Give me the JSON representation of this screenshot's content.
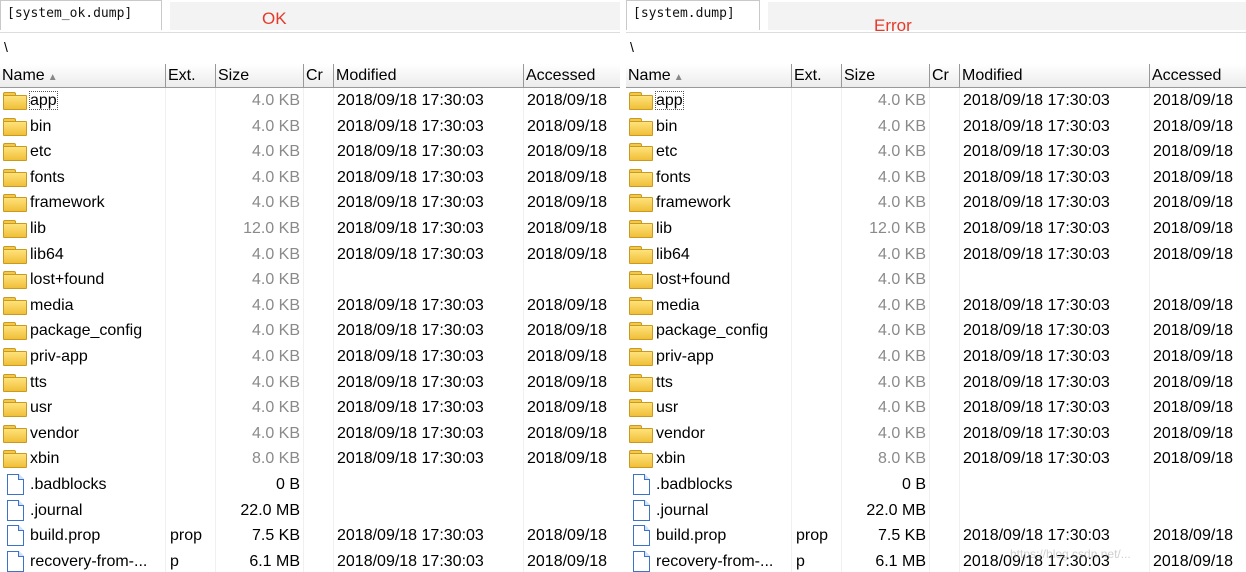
{
  "left": {
    "tab_label": "[system_ok.dump]",
    "status_text": "OK",
    "path": "\\"
  },
  "right": {
    "tab_label": "[system.dump]",
    "status_text": "Error",
    "path": "\\"
  },
  "columns": {
    "name": "Name",
    "ext": "Ext.",
    "size": "Size",
    "cr": "Cr",
    "modified": "Modified",
    "accessed": "Accessed"
  },
  "files": [
    {
      "icon": "folder-icon",
      "name": "app",
      "ext": "",
      "size": "4.0 KB",
      "modified": "2018/09/18  17:30:03",
      "accessed": "2018/09/18"
    },
    {
      "icon": "folder-icon",
      "name": "bin",
      "ext": "",
      "size": "4.0 KB",
      "modified": "2018/09/18  17:30:03",
      "accessed": "2018/09/18"
    },
    {
      "icon": "folder-icon",
      "name": "etc",
      "ext": "",
      "size": "4.0 KB",
      "modified": "2018/09/18  17:30:03",
      "accessed": "2018/09/18"
    },
    {
      "icon": "folder-icon",
      "name": "fonts",
      "ext": "",
      "size": "4.0 KB",
      "modified": "2018/09/18  17:30:03",
      "accessed": "2018/09/18"
    },
    {
      "icon": "folder-icon",
      "name": "framework",
      "ext": "",
      "size": "4.0 KB",
      "modified": "2018/09/18  17:30:03",
      "accessed": "2018/09/18"
    },
    {
      "icon": "folder-icon",
      "name": "lib",
      "ext": "",
      "size": "12.0 KB",
      "modified": "2018/09/18  17:30:03",
      "accessed": "2018/09/18"
    },
    {
      "icon": "folder-icon",
      "name": "lib64",
      "ext": "",
      "size": "4.0 KB",
      "modified": "2018/09/18  17:30:03",
      "accessed": "2018/09/18"
    },
    {
      "icon": "folder-icon",
      "name": "lost+found",
      "ext": "",
      "size": "4.0 KB",
      "modified": "",
      "accessed": ""
    },
    {
      "icon": "folder-icon",
      "name": "media",
      "ext": "",
      "size": "4.0 KB",
      "modified": "2018/09/18  17:30:03",
      "accessed": "2018/09/18"
    },
    {
      "icon": "folder-icon",
      "name": "package_config",
      "ext": "",
      "size": "4.0 KB",
      "modified": "2018/09/18  17:30:03",
      "accessed": "2018/09/18"
    },
    {
      "icon": "folder-icon",
      "name": "priv-app",
      "ext": "",
      "size": "4.0 KB",
      "modified": "2018/09/18  17:30:03",
      "accessed": "2018/09/18"
    },
    {
      "icon": "folder-icon",
      "name": "tts",
      "ext": "",
      "size": "4.0 KB",
      "modified": "2018/09/18  17:30:03",
      "accessed": "2018/09/18"
    },
    {
      "icon": "folder-icon",
      "name": "usr",
      "ext": "",
      "size": "4.0 KB",
      "modified": "2018/09/18  17:30:03",
      "accessed": "2018/09/18"
    },
    {
      "icon": "folder-icon",
      "name": "vendor",
      "ext": "",
      "size": "4.0 KB",
      "modified": "2018/09/18  17:30:03",
      "accessed": "2018/09/18"
    },
    {
      "icon": "folder-icon",
      "name": "xbin",
      "ext": "",
      "size": "8.0 KB",
      "modified": "2018/09/18  17:30:03",
      "accessed": "2018/09/18"
    },
    {
      "icon": "file-icon",
      "name": ".badblocks",
      "ext": "",
      "size": "0 B",
      "modified": "",
      "accessed": ""
    },
    {
      "icon": "file-icon",
      "name": ".journal",
      "ext": "",
      "size": "22.0 MB",
      "modified": "",
      "accessed": ""
    },
    {
      "icon": "file-icon",
      "name": "build.prop",
      "ext": "prop",
      "size": "7.5 KB",
      "modified": "2018/09/18  17:30:03",
      "accessed": "2018/09/18"
    },
    {
      "icon": "file-icon",
      "name": "recovery-from-...",
      "ext": "p",
      "size": "6.1 MB",
      "modified": "2018/09/18  17:30:03",
      "accessed": "2018/09/18"
    }
  ],
  "watermark": "https://blog.csdn.net/...",
  "colors": {
    "status": "#e53a2a",
    "folder": "#f0bf3a",
    "file_border": "#3c72c8"
  }
}
